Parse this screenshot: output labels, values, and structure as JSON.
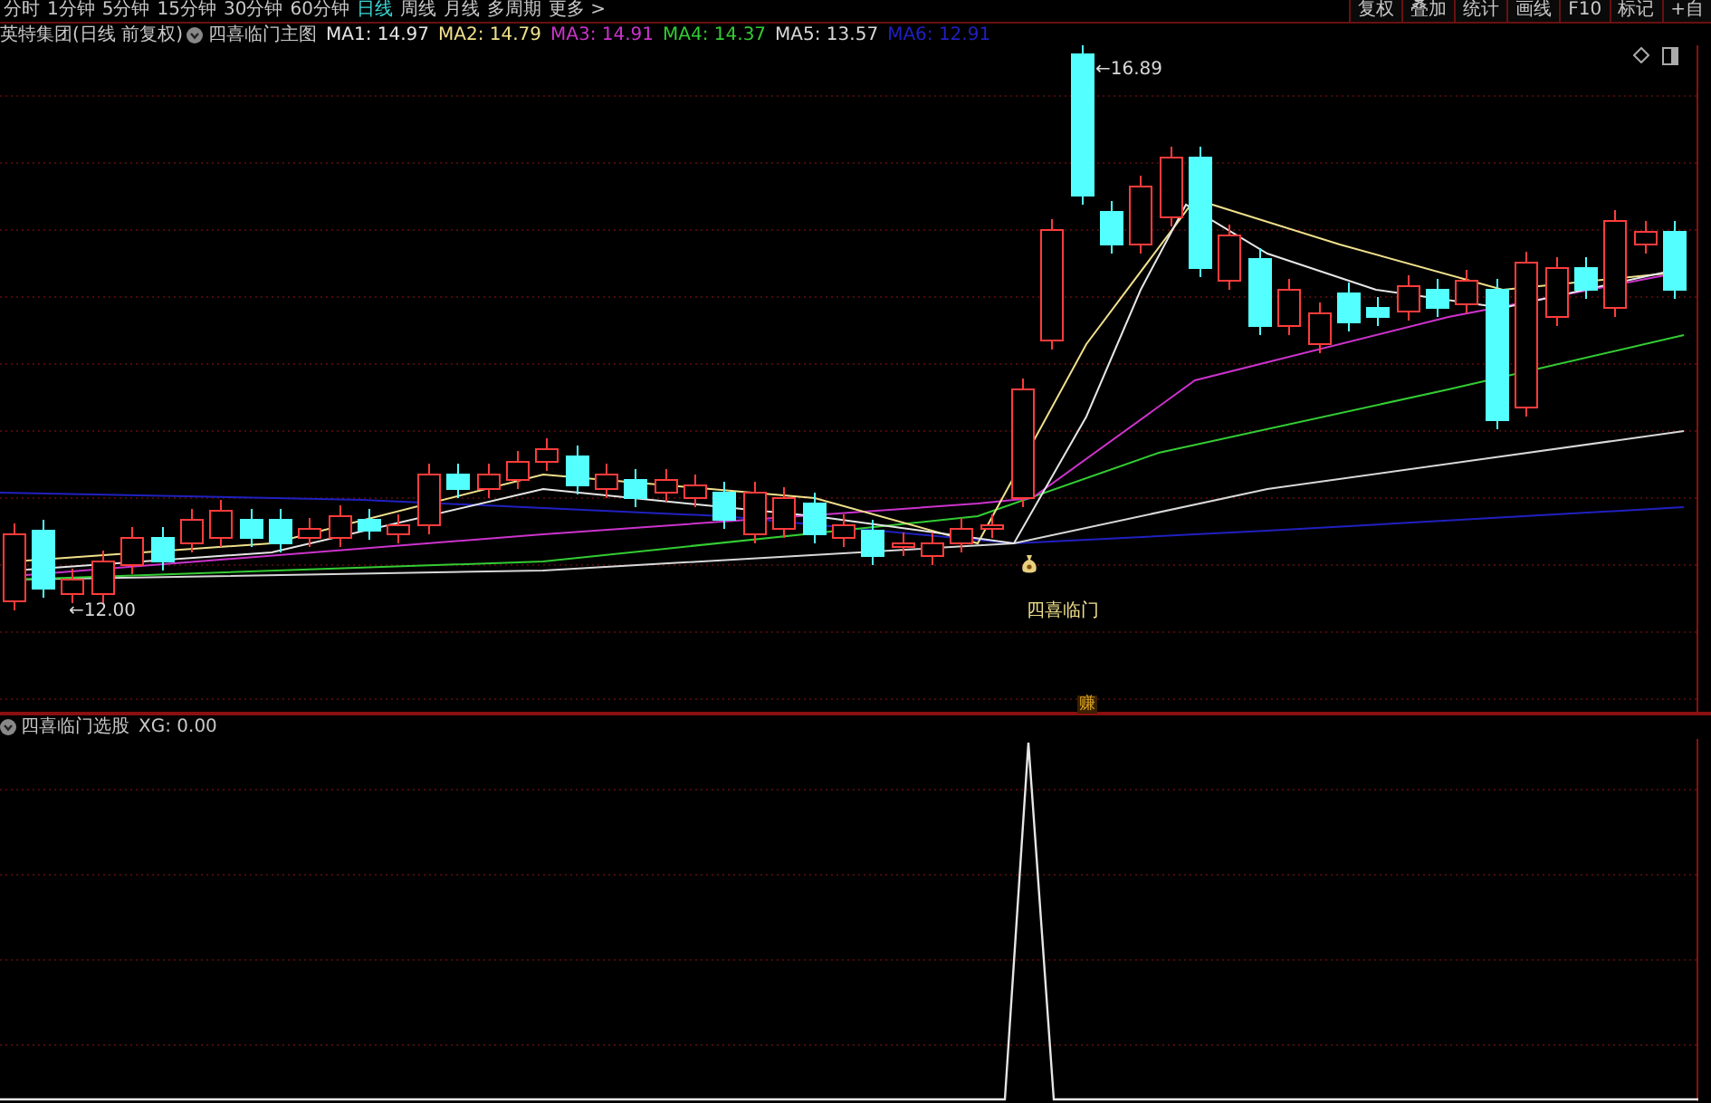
{
  "toolbar": {
    "tabs": [
      {
        "label": "分时",
        "selected": false
      },
      {
        "label": "1分钟",
        "selected": false
      },
      {
        "label": "5分钟",
        "selected": false
      },
      {
        "label": "15分钟",
        "selected": false
      },
      {
        "label": "30分钟",
        "selected": false
      },
      {
        "label": "60分钟",
        "selected": false
      },
      {
        "label": "日线",
        "selected": true
      },
      {
        "label": "周线",
        "selected": false
      },
      {
        "label": "月线",
        "selected": false
      },
      {
        "label": "多周期",
        "selected": false
      },
      {
        "label": "更多 >",
        "selected": false
      }
    ],
    "buttons": [
      "复权",
      "叠加",
      "统计",
      "画线",
      "F10",
      "标记",
      "+自"
    ]
  },
  "legend": {
    "title": "英特集团(日线 前复权)",
    "formula": "四喜临门主图",
    "ma": [
      {
        "text": "MA1: 14.97",
        "color": "#e6e6e6"
      },
      {
        "text": "MA2: 14.79",
        "color": "#f0e08c"
      },
      {
        "text": "MA3: 14.91",
        "color": "#cc33cc"
      },
      {
        "text": "MA4: 14.37",
        "color": "#33cc33"
      },
      {
        "text": "MA5: 13.57",
        "color": "#d8d8d8"
      },
      {
        "text": "MA6: 12.91",
        "color": "#2020c0"
      }
    ]
  },
  "price_labels": [
    {
      "kind": "high",
      "text": "←16.89"
    },
    {
      "kind": "low",
      "text": "←12.00"
    }
  ],
  "signal": {
    "label": "四喜临门",
    "marker": "赚"
  },
  "lower_pane": {
    "title": "四喜临门选股",
    "reading": "XG: 0.00"
  }
}
